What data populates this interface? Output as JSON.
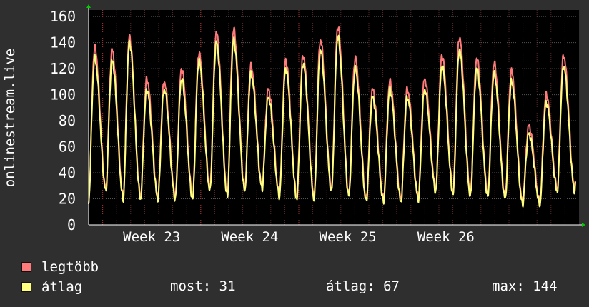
{
  "chart_data": {
    "type": "line",
    "ylabel": "onlinestream.live",
    "ylim": [
      0,
      165
    ],
    "yticks": [
      0,
      20,
      40,
      60,
      80,
      100,
      120,
      140,
      160
    ],
    "xticks": [
      "Week 23",
      "Week 24",
      "Week 25",
      "Week 26"
    ],
    "grid": true,
    "legend_placement": "bottom-left",
    "days": 35,
    "series": [
      {
        "name": "legtöbb",
        "color": "#ff7a7a",
        "peaks": [
          136,
          134,
          144,
          112,
          110,
          120,
          132,
          148,
          150,
          122,
          104,
          126,
          130,
          142,
          152,
          128,
          104,
          110,
          104,
          112,
          130,
          144,
          128,
          124,
          118,
          76,
          100,
          130
        ],
        "lows": [
          16,
          28,
          22,
          22,
          22,
          22,
          22,
          28,
          24,
          28,
          30,
          24,
          22,
          22,
          28,
          24,
          20,
          20,
          20,
          22,
          28,
          26,
          24,
          24,
          22,
          18,
          18,
          28
        ]
      },
      {
        "name": "átlag",
        "color": "#ffff80",
        "peaks": [
          128,
          126,
          140,
          104,
          104,
          112,
          126,
          140,
          142,
          116,
          98,
          120,
          124,
          134,
          144,
          120,
          98,
          104,
          98,
          104,
          122,
          134,
          120,
          116,
          110,
          70,
          94,
          122
        ],
        "lows": [
          16,
          26,
          20,
          20,
          20,
          20,
          20,
          26,
          22,
          26,
          28,
          22,
          20,
          20,
          26,
          22,
          18,
          18,
          18,
          20,
          26,
          24,
          22,
          22,
          20,
          16,
          16,
          26
        ]
      }
    ]
  },
  "legend": [
    {
      "label": "legtöbb",
      "color": "#ff7a7a"
    },
    {
      "label": "átlag",
      "color": "#ffff80"
    }
  ],
  "stats": {
    "most": "most: 31",
    "atlag": "átlag: 67",
    "max": "max: 144"
  }
}
